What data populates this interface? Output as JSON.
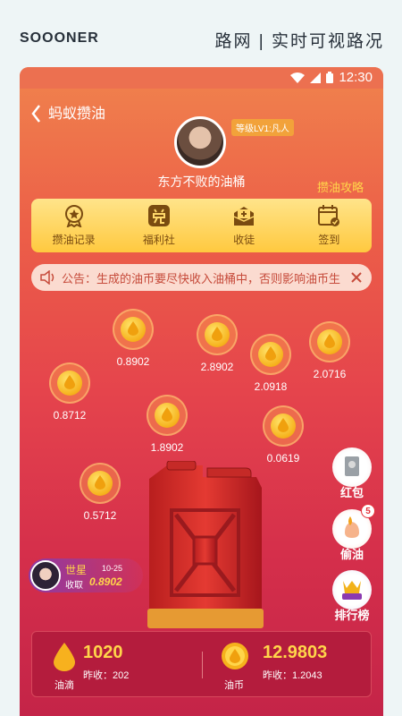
{
  "banner": {
    "brand": "SOOONER",
    "slogan": "路网 | 实时可视路况"
  },
  "statusbar": {
    "time": "12:30"
  },
  "header": {
    "back_icon": "chevron-left-icon",
    "title": "蚂蚁攒油"
  },
  "profile": {
    "level": "等级LV1:凡人",
    "nickname": "东方不败的油桶",
    "strategy_link": "攒油攻略"
  },
  "menu": [
    {
      "label": "攒油记录",
      "icon": "medal-icon"
    },
    {
      "label": "福利社",
      "icon": "redeem-icon"
    },
    {
      "label": "收徒",
      "icon": "inbox-plus-icon"
    },
    {
      "label": "签到",
      "icon": "calendar-check-icon"
    }
  ],
  "notice": {
    "icon": "speaker-icon",
    "text": "公告：生成的油币要尽快收入油桶中，否则影响油币生",
    "close_icon": "close-icon"
  },
  "coins": [
    {
      "value": "0.8902"
    },
    {
      "value": "2.8902"
    },
    {
      "value": "2.0918"
    },
    {
      "value": "2.0716"
    },
    {
      "value": "0.8712"
    },
    {
      "value": "1.8902"
    },
    {
      "value": "0.0619"
    },
    {
      "value": "0.5712"
    }
  ],
  "side_buttons": {
    "red_packet": "红包",
    "steal_oil": "偷油",
    "steal_badge": "5",
    "leaderboard": "排行榜"
  },
  "stealer": {
    "name": "世星",
    "date": "10-25",
    "gather_label": "收取",
    "amount": "0.8902"
  },
  "bottom": {
    "drops": {
      "value": "1020",
      "yesterday": "昨收：202",
      "label": "油滴"
    },
    "coins": {
      "value": "12.9803",
      "yesterday": "昨收：1.2043",
      "label": "油币"
    }
  },
  "colors": {
    "accent": "#ffd54a",
    "background_top": "#f0834d",
    "background_bottom": "#c42448"
  }
}
